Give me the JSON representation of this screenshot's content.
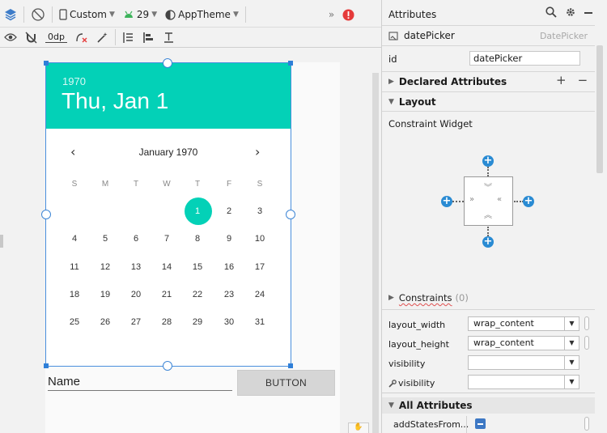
{
  "toolbar": {
    "device": "Custom",
    "api_level": "29",
    "theme": "AppTheme",
    "overflow": "»",
    "margin": "0dp"
  },
  "datepicker": {
    "year": "1970",
    "date": "Thu, Jan 1",
    "month": "January 1970",
    "prev": "‹",
    "next": "›",
    "dow": [
      "S",
      "M",
      "T",
      "W",
      "T",
      "F",
      "S"
    ],
    "weeks": [
      [
        "",
        "",
        "",
        "",
        "1",
        "2",
        "3"
      ],
      [
        "4",
        "5",
        "6",
        "7",
        "8",
        "9",
        "10"
      ],
      [
        "11",
        "12",
        "13",
        "14",
        "15",
        "16",
        "17"
      ],
      [
        "18",
        "19",
        "20",
        "21",
        "22",
        "23",
        "24"
      ],
      [
        "25",
        "26",
        "27",
        "28",
        "29",
        "30",
        "31"
      ]
    ],
    "selected_day": "1",
    "accent": "#03d1b7"
  },
  "form": {
    "name": "Name",
    "button": "BUTTON"
  },
  "attributes": {
    "title": "Attributes",
    "component_name": "datePicker",
    "component_type": "DatePicker",
    "id_label": "id",
    "id_value": "datePicker",
    "declared": "Declared Attributes",
    "plus": "+",
    "minus": "−",
    "layout": "Layout",
    "constraint_widget": "Constraint Widget",
    "constraints_label": "Constraints",
    "constraints_count": "(0)",
    "fields": [
      {
        "label": "layout_width",
        "value": "wrap_content"
      },
      {
        "label": "layout_height",
        "value": "wrap_content"
      },
      {
        "label": "visibility",
        "value": ""
      },
      {
        "label": "visibility",
        "value": ""
      }
    ],
    "all_attributes": "All Attributes",
    "add_states": "addStatesFrom..."
  }
}
